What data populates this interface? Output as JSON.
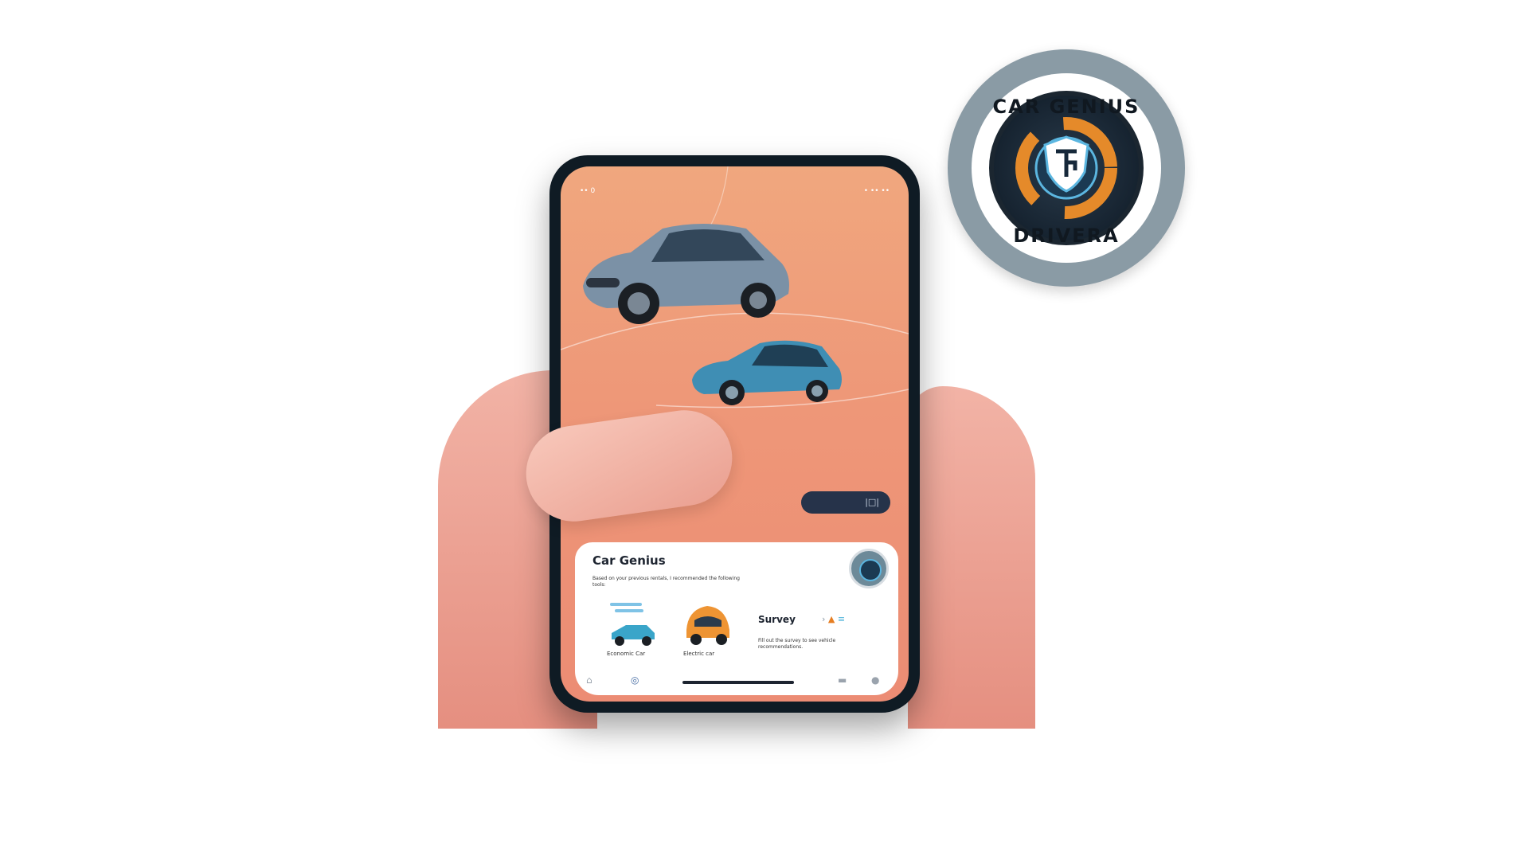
{
  "phone": {
    "status_left": "•• 0",
    "status_right": "• •• ••",
    "pill_label": "|□|",
    "colors": {
      "screen_top": "#f0a77e",
      "screen_bottom": "#ec8c74",
      "pill": "#26334a"
    }
  },
  "card": {
    "title": "Car Genius",
    "description": "Based on your previous rentals, I recommended the following tools:",
    "items": [
      {
        "label": "Economic Car"
      },
      {
        "label": "Electric car"
      }
    ],
    "survey_title": "Survey",
    "survey_desc": "Fill out the survey to see vehicle recommendations.",
    "survey_icons": [
      "arrow-icon",
      "warning-icon",
      "menu-icon"
    ]
  },
  "nav": {
    "items": [
      "home-icon",
      "chat-icon",
      "car-icon",
      "profile-icon"
    ]
  },
  "badge": {
    "top_text": "CAR GENIUS",
    "bottom_text": "DRIVERA",
    "colors": {
      "outer": "#8a9ba5",
      "accent": "#5bb6e0",
      "orange": "#e58a2a"
    }
  }
}
